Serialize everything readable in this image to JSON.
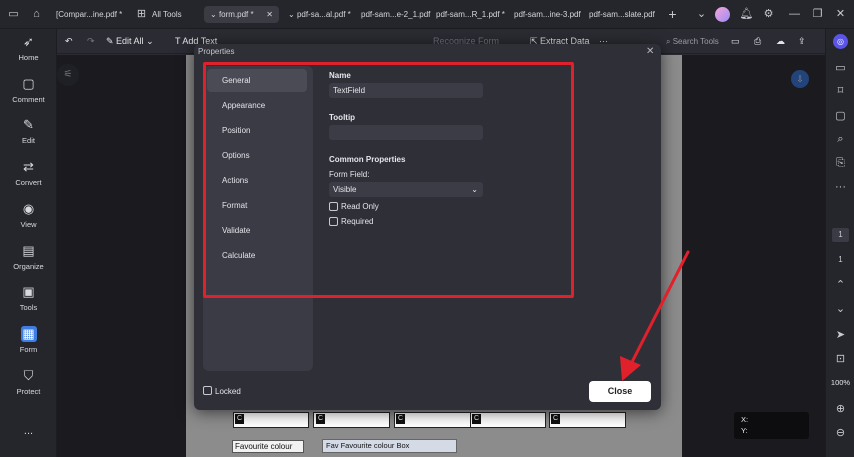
{
  "titlebar": {
    "tabs": [
      {
        "label": "[Compar...ine.pdf *"
      },
      {
        "label": "All Tools"
      },
      {
        "label": "form.pdf *"
      },
      {
        "label": "pdf-sa...al.pdf *"
      },
      {
        "label": "pdf-sam...e-2_1.pdf"
      },
      {
        "label": "pdf-sam...R_1.pdf *"
      },
      {
        "label": "pdf-sam...ine-3.pdf"
      },
      {
        "label": "pdf-sam...slate.pdf"
      }
    ]
  },
  "sidebar": {
    "items": [
      {
        "label": "Home",
        "icon": "rocket-icon"
      },
      {
        "label": "Comment",
        "icon": "comment-icon"
      },
      {
        "label": "Edit",
        "icon": "edit-icon"
      },
      {
        "label": "Convert",
        "icon": "convert-icon"
      },
      {
        "label": "View",
        "icon": "eye-icon"
      },
      {
        "label": "Organize",
        "icon": "organize-icon"
      },
      {
        "label": "Tools",
        "icon": "toolbox-icon"
      },
      {
        "label": "Form",
        "icon": "form-icon"
      },
      {
        "label": "Protect",
        "icon": "shield-icon"
      }
    ],
    "more": "..."
  },
  "toolbar": {
    "edit_all": "Edit All",
    "add_text": "Add Text",
    "recognize_form": "Recognize Form",
    "extract_data": "Extract Data",
    "search_tools": "Search Tools"
  },
  "dialog": {
    "title": "Properties",
    "nav": [
      "General",
      "Appearance",
      "Position",
      "Options",
      "Actions",
      "Format",
      "Validate",
      "Calculate"
    ],
    "name_label": "Name",
    "name_value": "TextField",
    "tooltip_label": "Tooltip",
    "tooltip_value": "",
    "common_label": "Common Properties",
    "form_field_label": "Form Field:",
    "form_field_value": "Visible",
    "read_only": "Read Only",
    "required": "Required",
    "locked": "Locked",
    "close": "Close"
  },
  "rightbar": {
    "page_current": "1",
    "page_total": "1",
    "zoom": "100%"
  },
  "doc": {
    "fav_label": "Favourite colour",
    "fav_box_text": "Fav  Favourite colour  Box",
    "c_glyph": "C",
    "x_label": "X:",
    "y_label": "Y:"
  },
  "colors": {
    "accent_red": "#e0212b",
    "sidebar_bg": "#25262c",
    "dialog_bg": "#2e2f37"
  }
}
